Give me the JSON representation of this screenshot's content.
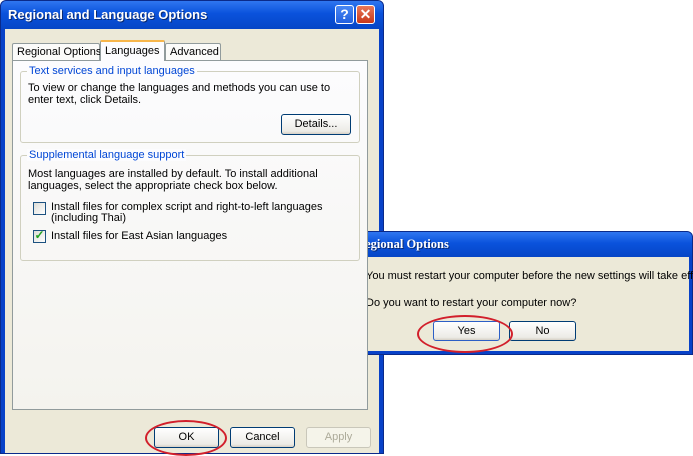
{
  "main_window": {
    "title": "Regional and Language Options",
    "help_glyph": "?",
    "close_glyph": "✕",
    "tabs": [
      {
        "label": "Regional Options"
      },
      {
        "label": "Languages"
      },
      {
        "label": "Advanced"
      }
    ],
    "active_tab": "Languages",
    "text_services": {
      "legend": "Text services and input languages",
      "description": "To view or change the languages and methods you can use to enter text, click Details.",
      "details_button": "Details..."
    },
    "supplemental": {
      "legend": "Supplemental language support",
      "description": "Most languages are installed by default. To install additional languages, select the appropriate check box below.",
      "checkboxes": [
        {
          "label": "Install files for complex script and right-to-left languages (including Thai)",
          "checked": false
        },
        {
          "label": "Install files for East Asian languages",
          "checked": true
        }
      ]
    },
    "buttons": {
      "ok": "OK",
      "cancel": "Cancel",
      "apply": "Apply"
    }
  },
  "dialog": {
    "title": "Change Regional Options",
    "message": "You must restart your computer before the new settings will take effect.",
    "question": "Do you want to restart your computer now?",
    "icon": "question-icon",
    "icon_glyph": "?",
    "check_glyph": "✓",
    "buttons": {
      "yes": "Yes",
      "no": "No"
    }
  },
  "colors": {
    "title_bar": "#0a52dc",
    "legend_text": "#0046d5",
    "annotation_circle": "#d21f2b",
    "checkmark": "#21a121"
  }
}
